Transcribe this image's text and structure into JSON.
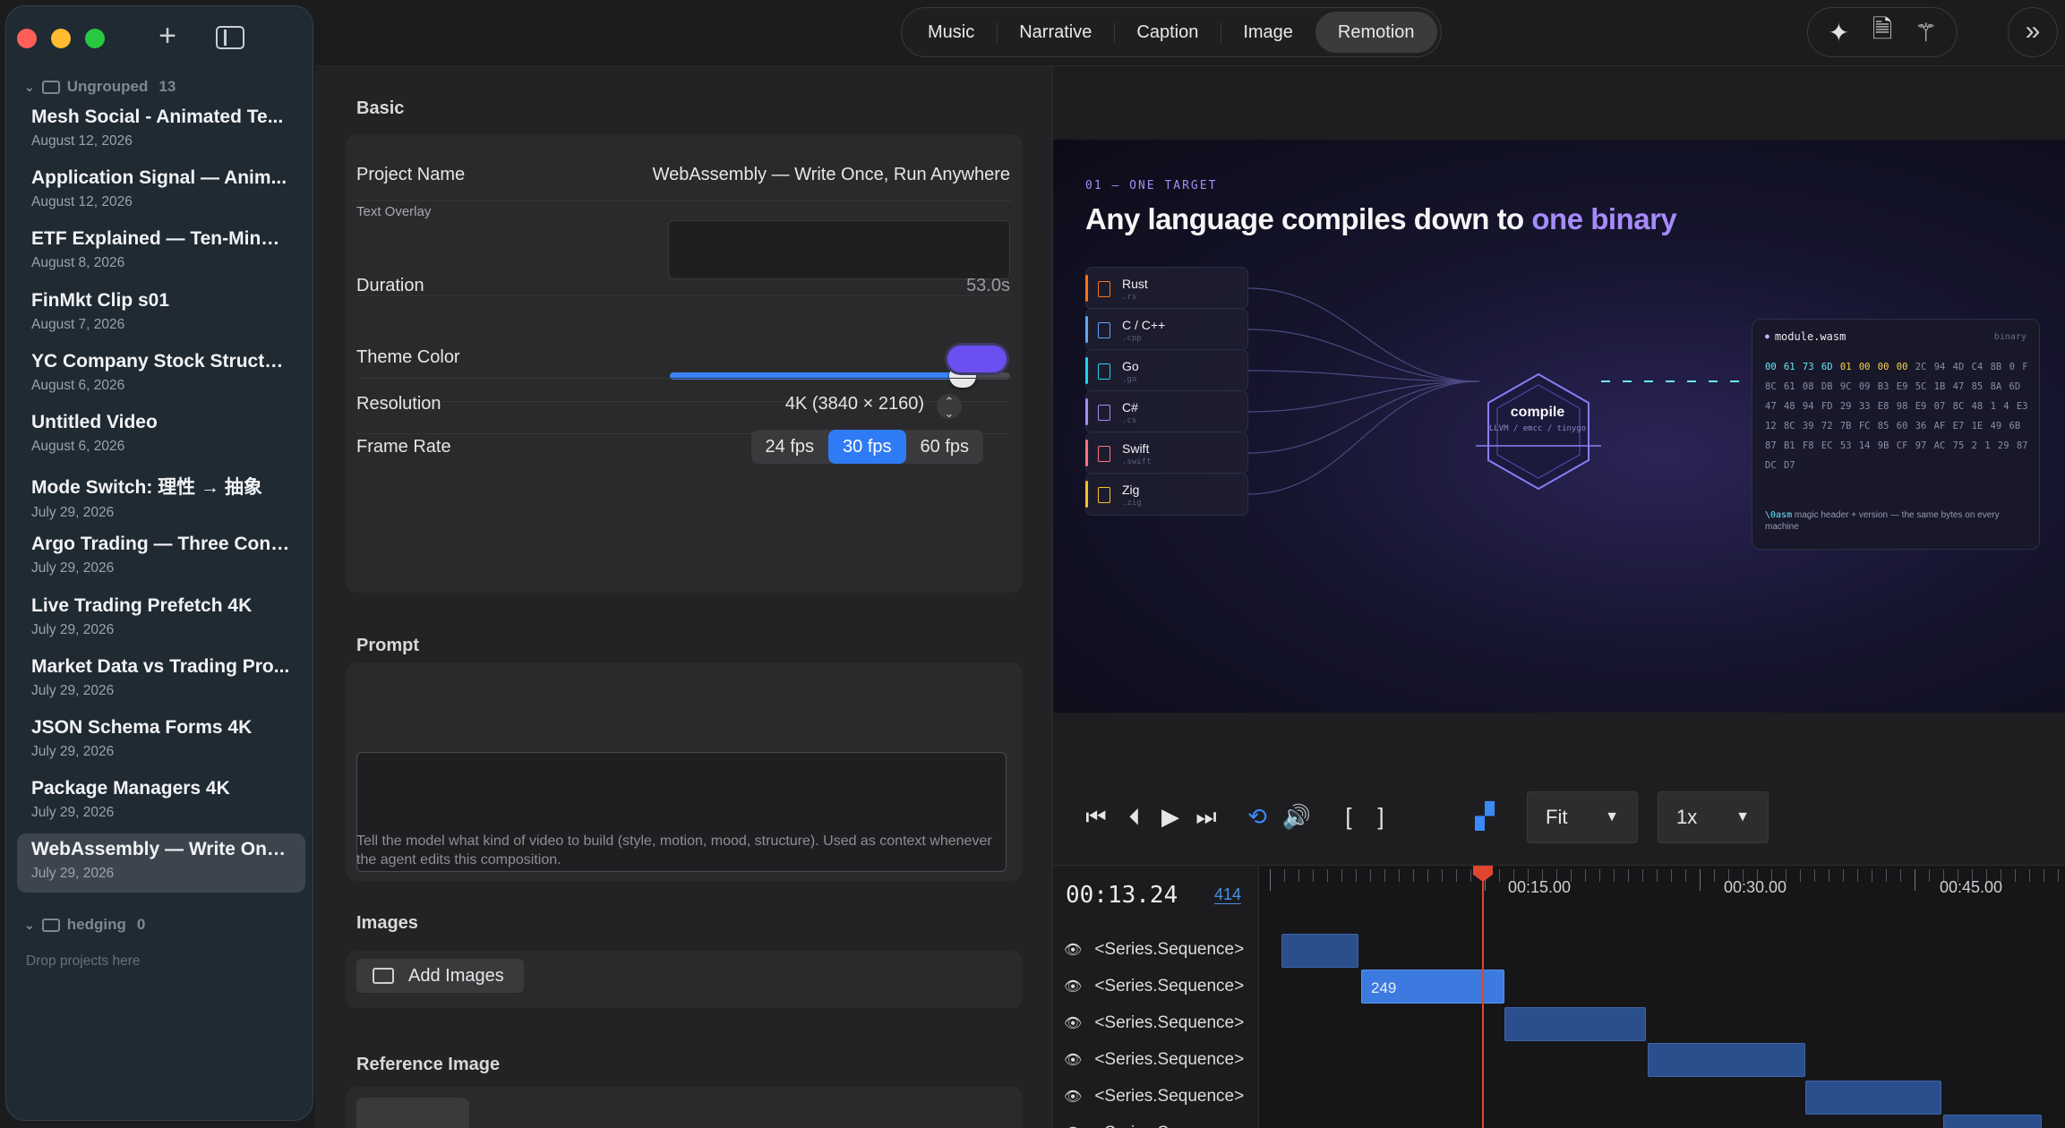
{
  "sidebar": {
    "groups": [
      {
        "name": "Ungrouped",
        "count": "13"
      },
      {
        "name": "hedging",
        "count": "0"
      }
    ],
    "projects": [
      {
        "title": "Mesh Social - Animated Te...",
        "date": "August 12, 2026"
      },
      {
        "title": "Application Signal — Anim...",
        "date": "August 12, 2026"
      },
      {
        "title": "ETF Explained — Ten-Minut...",
        "date": "August 8, 2026"
      },
      {
        "title": "FinMkt Clip s01",
        "date": "August 7, 2026"
      },
      {
        "title": "YC Company Stock Structu...",
        "date": "August 6, 2026"
      },
      {
        "title": "Untitled Video",
        "date": "August 6, 2026"
      },
      {
        "title": "Mode Switch: 理性 → 抽象",
        "date": "July 29, 2026"
      },
      {
        "title": "Argo Trading — Three Conf...",
        "date": "July 29, 2026"
      },
      {
        "title": "Live Trading Prefetch 4K",
        "date": "July 29, 2026"
      },
      {
        "title": "Market Data vs Trading Pro...",
        "date": "July 29, 2026"
      },
      {
        "title": "JSON Schema Forms 4K",
        "date": "July 29, 2026"
      },
      {
        "title": "Package Managers 4K",
        "date": "July 29, 2026"
      },
      {
        "title": "WebAssembly — Write Onc...",
        "date": "July 29, 2026"
      }
    ],
    "drop_hint": "Drop projects here"
  },
  "tabs": [
    "Music",
    "Narrative",
    "Caption",
    "Image",
    "Remotion"
  ],
  "active_tab": "Remotion",
  "basic": {
    "section": "Basic",
    "project_name_label": "Project Name",
    "project_name": "WebAssembly — Write Once, Run Anywhere",
    "text_overlay_label": "Text Overlay",
    "text_overlay": "",
    "duration_label": "Duration",
    "duration": "53.0s",
    "duration_fraction": 0.86,
    "theme_label": "Theme Color",
    "theme_color": "#6b4ff0",
    "resolution_label": "Resolution",
    "resolution": "4K (3840 × 2160)",
    "frame_rate_label": "Frame Rate",
    "frame_rates": [
      "24 fps",
      "30 fps",
      "60 fps"
    ],
    "frame_rate": "30 fps"
  },
  "prompt": {
    "section": "Prompt",
    "value": "",
    "help": "Tell the model what kind of video to build (style, motion, mood, structure). Used as context whenever the agent edits this composition."
  },
  "images": {
    "section": "Images",
    "add_label": "Add Images"
  },
  "reference": {
    "section": "Reference Image"
  },
  "video": {
    "kicker": "01 — ONE TARGET",
    "title_pre": "Any language compiles down to ",
    "title_hl": "one binary",
    "languages": [
      {
        "name": "Rust",
        "ext": ".rs",
        "color": "#f97316"
      },
      {
        "name": "C / C++",
        "ext": ".cpp",
        "color": "#60a5fa"
      },
      {
        "name": "Go",
        "ext": ".go",
        "color": "#22d3ee"
      },
      {
        "name": "C#",
        "ext": ".cs",
        "color": "#a78bfa"
      },
      {
        "name": "Swift",
        "ext": ".swift",
        "color": "#fb7185"
      },
      {
        "name": "Zig",
        "ext": ".zig",
        "color": "#fbbf24"
      }
    ],
    "compile_label": "compile",
    "compile_sub": "LLVM / emcc / tinygo",
    "wasm_file": "module.wasm",
    "wasm_tag": "binary",
    "wasm_hex_cyan": "00 61 73 6D",
    "wasm_hex_yellow": "01 00 00 00",
    "wasm_hex_rest": "2C 94 4D C4 8B 0 F 8C 61 08 DB 9C 09 B3 E9 5C 1B 47 85 8A 6D 47 48 94 FD 29 33 E8 98 E9 07 8C 48 1 4 E3 12 8C 39 72 7B FC 85 60 36 AF E7 1E 49 6B 87 B1 F8 EC 53 14 9B CF 97 AC 75 2 1 29 87 DC D7",
    "wasm_magic": "\\0asm",
    "wasm_note": " magic header + version — the same bytes on every machine"
  },
  "controls": {
    "zoom": "Fit",
    "speed": "1x"
  },
  "timeline": {
    "timecode": "00:13.24",
    "frame": "414",
    "ruler_labels": [
      "00:15.00",
      "00:30.00",
      "00:45.00"
    ],
    "tracks": [
      "<Series.Sequence>",
      "<Series.Sequence>",
      "<Series.Sequence>",
      "<Series.Sequence>",
      "<Series.Sequence>",
      "<Series.Sequence>"
    ],
    "highlight_label": "249"
  }
}
